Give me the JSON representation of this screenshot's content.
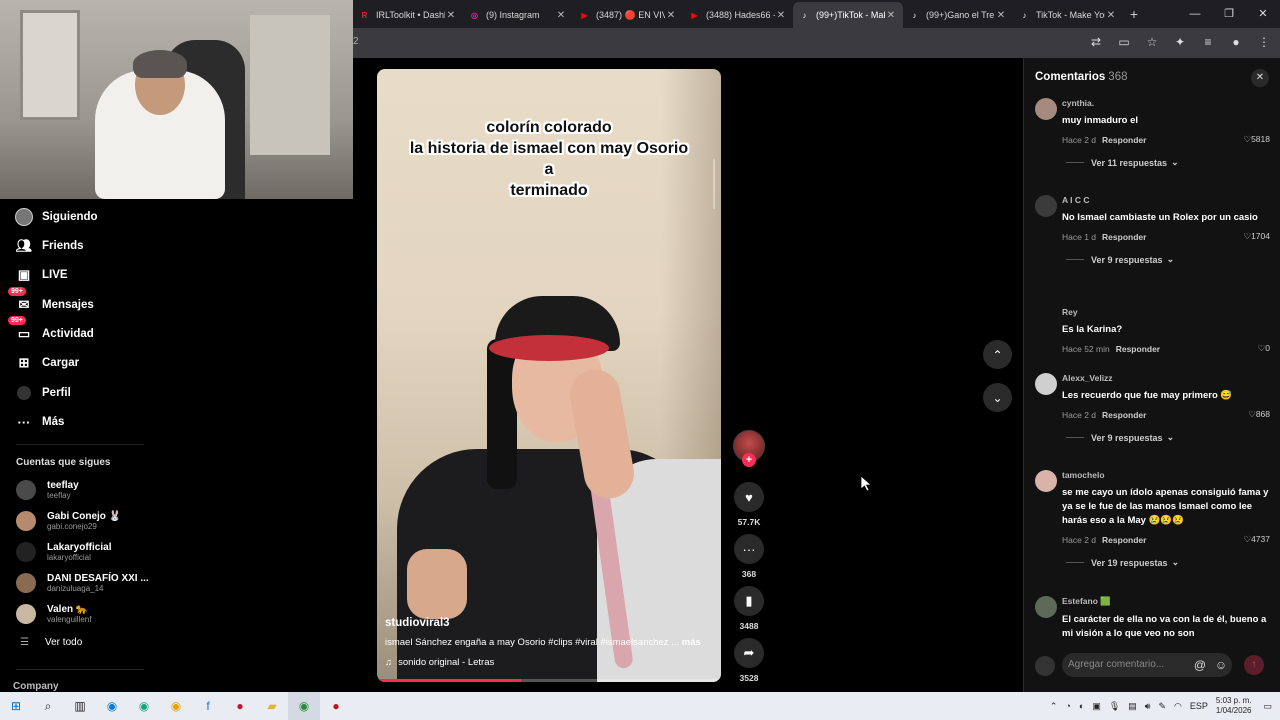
{
  "browser": {
    "tabs": [
      {
        "title": "IRLToolkit • Dashb",
        "favicon": "R",
        "color": "#d92d2d",
        "active": false
      },
      {
        "title": "(9) Instagram",
        "favicon": "◎",
        "color": "#d6249f",
        "active": false
      },
      {
        "title": "(3487) 🔴 EN VIV",
        "favicon": "▶",
        "color": "#ff0000",
        "active": false
      },
      {
        "title": "(3488) Hades66 -",
        "favicon": "▶",
        "color": "#ff0000",
        "active": false
      },
      {
        "title": "(99+)TikTok - Mak",
        "favicon": "♪",
        "color": "#111111",
        "active": true
      },
      {
        "title": "(99+)Gano el Tre",
        "favicon": "♪",
        "color": "#111111",
        "active": false
      },
      {
        "title": "TikTok - Make You",
        "favicon": "♪",
        "color": "#111111",
        "active": false
      }
    ],
    "address_fragment": "2"
  },
  "nav": {
    "items": [
      {
        "label": "Siguiendo",
        "icon": "avatar-icon"
      },
      {
        "label": "Friends",
        "icon": "friends-icon"
      },
      {
        "label": "LIVE",
        "icon": "live-icon"
      },
      {
        "label": "Mensajes",
        "icon": "messages-icon",
        "badge": "99+"
      },
      {
        "label": "Actividad",
        "icon": "activity-icon",
        "badge": "99+"
      },
      {
        "label": "Cargar",
        "icon": "upload-icon"
      },
      {
        "label": "Perfil",
        "icon": "profile-icon"
      },
      {
        "label": "Más",
        "icon": "more-icon"
      }
    ],
    "following_title": "Cuentas que sigues",
    "accounts": [
      {
        "name": "teeflay",
        "handle": "teeflay"
      },
      {
        "name": "Gabi Conejo 🐰",
        "handle": "gabi.conejo29"
      },
      {
        "name": "Lakaryofficial",
        "handle": "lakaryofficial"
      },
      {
        "name": "DANI DESAFÍO XXI ...",
        "handle": "danizuluaga_14"
      },
      {
        "name": "Valen 🐆",
        "handle": "valenguillenf"
      }
    ],
    "see_all": "Ver todo",
    "company": "Company"
  },
  "video": {
    "overlay_lines": [
      "colorín colorado",
      "la historia de ismael con may Osorio",
      "a",
      "terminado"
    ],
    "author": "studioviral3",
    "description": "ismael Sánchez engaña a may Osorio #clips #viral #ismaelsanchez ...",
    "more": "más",
    "music": "sonido original - Letras",
    "progress": 0.42
  },
  "actions": {
    "likes": "57.7K",
    "comments": "368",
    "saves": "3488",
    "shares": "3528"
  },
  "comments": {
    "title": "Comentarios",
    "count": "368",
    "input_placeholder": "Agregar comentario...",
    "reply_label": "Responder",
    "items": [
      {
        "user": "cynthia.",
        "text": "muy inmaduro el",
        "time": "Hace 2 d",
        "likes": "5818",
        "more": "Ver 11 respuestas"
      },
      {
        "user": "A I C C",
        "text": "No Ismael cambiaste un Rolex por un casio",
        "time": "Hace 1 d",
        "likes": "1704",
        "more": "Ver 9 respuestas"
      },
      {
        "user": "Rey",
        "text": "Es la Karina?",
        "time": "Hace 52 min",
        "likes": "0",
        "more": ""
      },
      {
        "user": "Alexx_Velizz",
        "text": "Les recuerdo que fue may primero 😅",
        "time": "Hace 2 d",
        "likes": "868",
        "more": "Ver 9 respuestas"
      },
      {
        "user": "tamochelo",
        "text": "se me cayo un ídolo apenas consiguió fama y ya se le fue de las manos Ismael como lee harás eso a la May 😢😢😢",
        "time": "Hace 2 d",
        "likes": "4737",
        "more": "Ver 19 respuestas"
      },
      {
        "user": "Estefano 🟩",
        "text": "El carácter de ella no va con la de él, bueno a mi visión a lo que veo no son",
        "time": "",
        "likes": "",
        "more": ""
      }
    ]
  },
  "taskbar": {
    "language": "ESP",
    "time": "5:03 p. m.",
    "date": "1/04/2026"
  }
}
